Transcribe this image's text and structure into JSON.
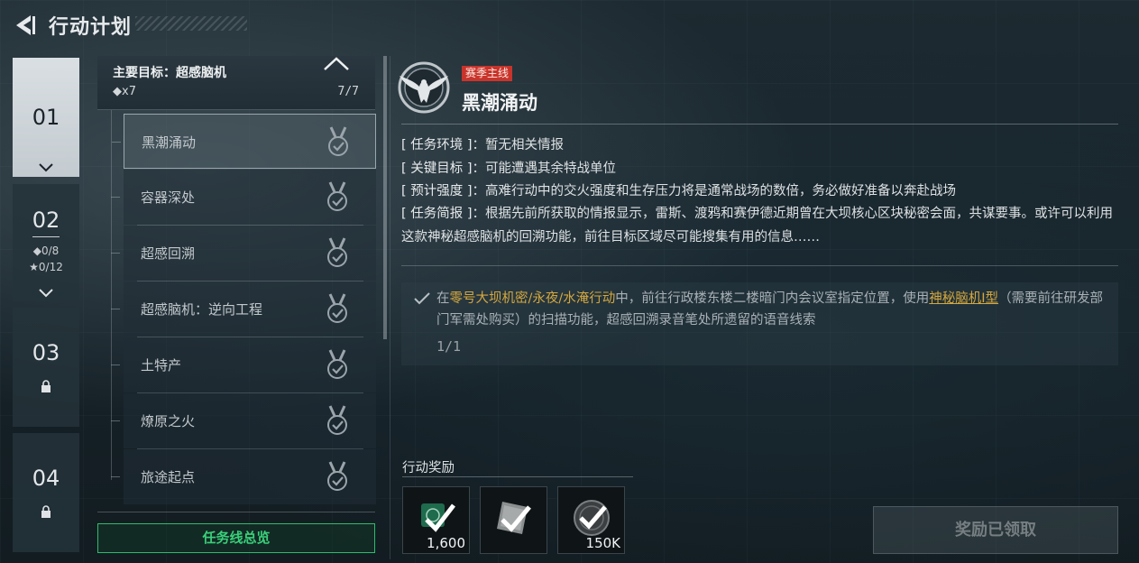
{
  "header": {
    "title": "行动计划"
  },
  "chapters": [
    {
      "num": "01",
      "state": "active"
    },
    {
      "num": "02",
      "diamond": "◆0/8",
      "star": "★0/12"
    },
    {
      "num": "03",
      "state": "locked"
    },
    {
      "num": "04",
      "state": "locked"
    }
  ],
  "goal": {
    "title": "主要目标：超感脑机",
    "count": "◆x7",
    "progress": "7/7"
  },
  "missions": [
    {
      "label": "黑潮涌动"
    },
    {
      "label": "容器深处"
    },
    {
      "label": "超感回溯"
    },
    {
      "label": "超感脑机：逆向工程"
    },
    {
      "label": "土特产"
    },
    {
      "label": "燎原之火"
    },
    {
      "label": "旅途起点"
    }
  ],
  "overview_button": "任务线总览",
  "detail": {
    "tag": "赛季主线",
    "name": "黑潮涌动",
    "rows": [
      {
        "key": "[ 任务环境 ]",
        "value": "：暂无相关情报"
      },
      {
        "key": "[ 关键目标 ]",
        "value": "：可能遭遇其余特战单位"
      },
      {
        "key": "[ 预计强度 ]",
        "value": "：高难行动中的交火强度和生存压力将是通常战场的数倍，务必做好准备以奔赴战场"
      },
      {
        "key": "[ 任务简报 ]",
        "value": "：根据先前所获取的情报显示，雷斯、渡鸦和赛伊德近期曾在大坝核心区块秘密会面，共谋要事。或许可以利用这款神秘超感脑机的回溯功能，前往目标区域尽可能搜集有用的信息……"
      }
    ],
    "objective": {
      "prefix": "在",
      "highlight": "零号大坝机密/永夜/水淹行动",
      "middle": "中，前往行政楼东楼二楼暗门内会议室指定位置，使用",
      "link": "神秘脑机Ⅰ型",
      "suffix": "（需要前往研发部门军需处购买）的扫描功能，超感回溯录音笔处所遗留的语音线索",
      "progress": "1/1"
    }
  },
  "rewards": {
    "label": "行动奖励",
    "items": [
      {
        "icon": "badge-icon",
        "qty": "1,600"
      },
      {
        "icon": "document-icon",
        "qty": ""
      },
      {
        "icon": "coin-icon",
        "qty": "150K"
      }
    ]
  },
  "claim_button": "奖励已领取",
  "colors": {
    "accent_green": "#39d07a",
    "highlight_gold": "#d4a73e",
    "tag_red": "#c8342b"
  }
}
